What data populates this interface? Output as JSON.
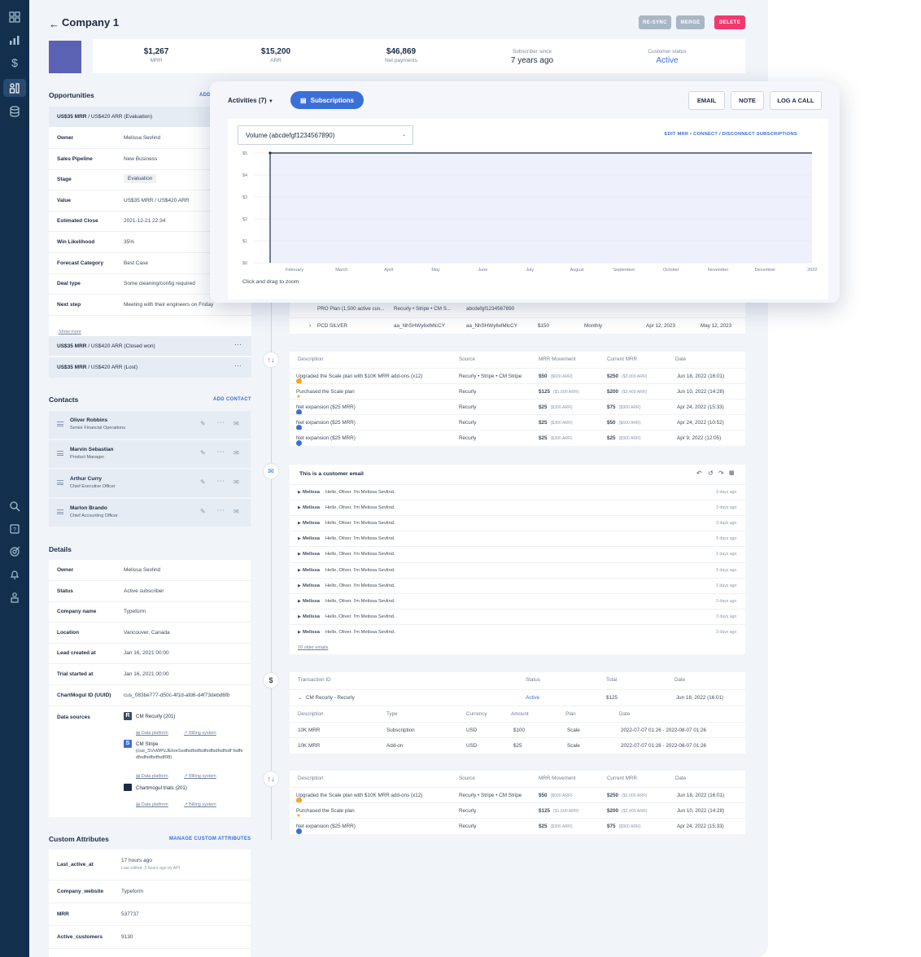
{
  "header": {
    "title": "Company 1",
    "resync": "RE-SYNC",
    "merge": "MERGE",
    "delete": "DELETE"
  },
  "kpis": [
    {
      "value": "$1,267",
      "label": "MRR"
    },
    {
      "value": "$15,200",
      "label": "ARR"
    },
    {
      "value": "$46,869",
      "label": "Net payments"
    },
    {
      "value": "7 years ago",
      "label": "Subscriber since"
    },
    {
      "value": "Active",
      "label": "Customer status"
    }
  ],
  "opportunities": {
    "title": "Opportunities",
    "add": "ADD",
    "open_head": {
      "amount": "US$35 MRR",
      "rest": " / US$420 ARR (Evaluation)"
    },
    "rows": [
      {
        "k": "Owner",
        "v": "Melissa Sevlind"
      },
      {
        "k": "Sales Pipeline",
        "v": "New Business"
      },
      {
        "k": "Stage",
        "v": "Evaluation"
      },
      {
        "k": "Value",
        "v": "US$35 MRR / US$420 ARR"
      },
      {
        "k": "Estimated Close",
        "v": "2021-12-21 22:34"
      },
      {
        "k": "Win Likelihood",
        "v": "35%"
      },
      {
        "k": "Forecast Category",
        "v": "Best Case"
      },
      {
        "k": "Deal type",
        "v": "Some cleaning/config required"
      },
      {
        "k": "Next step",
        "v": "Meeting with their engineers on Friday"
      }
    ],
    "show_more": "Show more",
    "closed": [
      {
        "amount": "US$35 MRR",
        "rest": " / US$420 ARR (Closed won)"
      },
      {
        "amount": "US$35 MRR",
        "rest": " / US$420 ARR (Lost)"
      }
    ]
  },
  "contacts": {
    "title": "Contacts",
    "add": "ADD CONTACT",
    "items": [
      {
        "name": "Oliver Robbins",
        "role": "Senior Financial Operations"
      },
      {
        "name": "Marvin Sebastian",
        "role": "Product Manager"
      },
      {
        "name": "Arthur Curry",
        "role": "Chief Executive Officer"
      },
      {
        "name": "Marlon Brando",
        "role": "Chief Accounting Officer"
      }
    ]
  },
  "details": {
    "title": "Details",
    "rows": [
      {
        "k": "Owner",
        "v": "Melissa Sevlind"
      },
      {
        "k": "Status",
        "v": "Active subscriber"
      },
      {
        "k": "Company name",
        "v": "Typeform"
      },
      {
        "k": "Location",
        "v": "Vancouver, Canada"
      },
      {
        "k": "Lead created at",
        "v": "Jan 16, 2021 00:00"
      },
      {
        "k": "Trial started at",
        "v": "Jan 16, 2021 00:00"
      },
      {
        "k": "ChartMogul ID (UUID)",
        "v": "cus_083be777-d50c-4f1d-afd6-d4f73debd6fb"
      }
    ],
    "data_sources_label": "Data sources",
    "sources": [
      {
        "name": "CM Recurly (201)",
        "extra": ""
      },
      {
        "name": "CM Stripe",
        "extra": "(cus_SVsWPzJEIoeSsdfsdfsdfsdfsdfsdfsdfsdf fsdfsdfsdfsdfsdfsdf08)"
      },
      {
        "name": "Chartmogul trials (201)",
        "extra": ""
      }
    ],
    "data_platform": "Data platform",
    "billing_system": "Billing system"
  },
  "custom_attrs": {
    "title": "Custom Attributes",
    "manage": "MANAGE CUSTOM ATTRIBUTES",
    "rows": [
      {
        "k": "Last_active_at",
        "v": "17 hours ago",
        "sub": "Last edited: 3 hours ago by API"
      },
      {
        "k": "Company_website",
        "v": "Typeform",
        "sub": ""
      },
      {
        "k": "MRR",
        "v": "537737",
        "sub": ""
      },
      {
        "k": "Active_customers",
        "v": "9130",
        "sub": ""
      }
    ]
  },
  "popup": {
    "activities": "Activities (7)",
    "subscriptions": "Subscriptions",
    "email": "EMAIL",
    "note": "NOTE",
    "log": "LOG A CALL",
    "select": "Volume (abcdefgf1234567890)",
    "edit_links": "EDIT MRR • CONNECT / DISCONNECT SUBSCRIPTIONS",
    "zoom": "Click and drag to zoom"
  },
  "chart_data": {
    "type": "area",
    "x": [
      "February",
      "March",
      "April",
      "May",
      "June",
      "July",
      "August",
      "September",
      "October",
      "November",
      "December",
      "2022"
    ],
    "series": [
      {
        "values": [
          5,
          5,
          5,
          5,
          5,
          5,
          5,
          5,
          5,
          5,
          5,
          5
        ]
      }
    ],
    "y_ticks": [
      "$5",
      "$4",
      "$3",
      "$2",
      "$1",
      "$0"
    ],
    "ylim": [
      0,
      5
    ],
    "grid": true
  },
  "subs_rows": [
    {
      "plan": "PRO Plan (1,500 active cus...",
      "source": "Recurly • Stripe • CM S...",
      "id": "abcdefgf1234567890",
      "price": "",
      "period": "",
      "start": "",
      "end": ""
    },
    {
      "plan": "PCD SILVER",
      "source": "aa_NhSHWy6xlMlcCY",
      "id": "aa_NhSHWy6xlMlcCY",
      "price": "$150",
      "period": "Monthly",
      "start": "Apr 12, 2023",
      "end": "May 12, 2023"
    }
  ],
  "mrr_table1": {
    "headers": [
      "Description",
      "Source",
      "MRR Movement",
      "Current MRR",
      "Date"
    ],
    "rows": [
      {
        "icon": "yellow",
        "desc": "Upgraded the Scale plan with $10K MRR add-ons (x12)",
        "src": "Recurly • Stripe • CM Stripe",
        "mov": "$50",
        "mov_arr": "($600 ARR)",
        "cur": "$250",
        "cur_arr": "($3,000 ARR)",
        "date": "Jun 18, 2022 (16:01)"
      },
      {
        "icon": "star",
        "desc": "Purchased the Scale plan",
        "src": "Recurly",
        "mov": "$125",
        "mov_arr": "($1,500 ARR)",
        "cur": "$200",
        "cur_arr": "($2,400 ARR)",
        "date": "Jun 10, 2022 (14:28)"
      },
      {
        "icon": "blue",
        "desc": "Net expansion ($25 MRR)",
        "src": "Recurly",
        "mov": "$25",
        "mov_arr": "($300 ARR)",
        "cur": "$75",
        "cur_arr": "($900 ARR)",
        "date": "Apr 24, 2022 (15:33)"
      },
      {
        "icon": "blue",
        "desc": "Net expansion ($25 MRR)",
        "src": "Recurly",
        "mov": "$25",
        "mov_arr": "($300 ARR)",
        "cur": "$50",
        "cur_arr": "($600 ARR)",
        "date": "Apr 24, 2022 (10:52)"
      },
      {
        "icon": "blue",
        "desc": "Net expansion ($25 MRR)",
        "src": "Recurly",
        "mov": "$25",
        "mov_arr": "($300 ARR)",
        "cur": "$25",
        "cur_arr": "($300 ARR)",
        "date": "Apr 9, 2022 (12:05)"
      }
    ]
  },
  "email_thread": {
    "subject": "This is a customer email",
    "sender": "Melissa",
    "preview": "Hello, Oliver. I'm Melissa Sevlind.",
    "time": "3 days ago",
    "count": 10,
    "older": "20 older emails"
  },
  "transactions": {
    "headers": [
      "Transaction ID",
      "Status",
      "Total",
      "Date"
    ],
    "row": {
      "id": "CM Recurly - Recurly",
      "status": "Active",
      "total": "$125",
      "date": "Jun 18, 2022 (16:01)"
    },
    "sub_headers": [
      "Description",
      "Type",
      "Currency",
      "Amount",
      "Plan",
      "Date"
    ],
    "sub_rows": [
      {
        "desc": "10K MRR",
        "type": "Subscription",
        "cur": "USD",
        "amt": "$100",
        "plan": "Scale",
        "date": "2022-07-07 01:26 - 2022-08-07 01:26"
      },
      {
        "desc": "10K MRR",
        "type": "Add-on",
        "cur": "USD",
        "amt": "$25",
        "plan": "Scale",
        "date": "2022-07-07 01:26 - 2022-08-07 01:26"
      }
    ]
  },
  "mrr_table2": {
    "headers": [
      "Description",
      "Source",
      "MRR Movement",
      "Current MRR",
      "Date"
    ],
    "rows": [
      {
        "icon": "yellow",
        "desc": "Upgraded the Scale plan with $10K MRR add-ons (x12)",
        "src": "Recurly • Stripe • CM Stripe",
        "mov": "$50",
        "mov_arr": "($600 ARR)",
        "cur": "$250",
        "cur_arr": "($3,000 ARR)",
        "date": "Jun 18, 2022 (16:01)"
      },
      {
        "icon": "star",
        "desc": "Purchased the Scale plan",
        "src": "Recurly",
        "mov": "$125",
        "mov_arr": "($1,500 ARR)",
        "cur": "$200",
        "cur_arr": "($2,400 ARR)",
        "date": "Jun 10, 2022 (14:28)"
      },
      {
        "icon": "blue",
        "desc": "Net expansion ($25 MRR)",
        "src": "Recurly",
        "mov": "$25",
        "mov_arr": "($300 ARR)",
        "cur": "$75",
        "cur_arr": "($900 ARR)",
        "date": "Apr 24, 2022 (15:33)"
      }
    ]
  },
  "colors": {
    "sidebar": "#12304d",
    "accent": "#3b6fd8",
    "delete": "#f2386f",
    "muted_btn": "#a9b6c6",
    "chart_line": "#1b2b45",
    "chart_fill": "#eef1fb"
  }
}
